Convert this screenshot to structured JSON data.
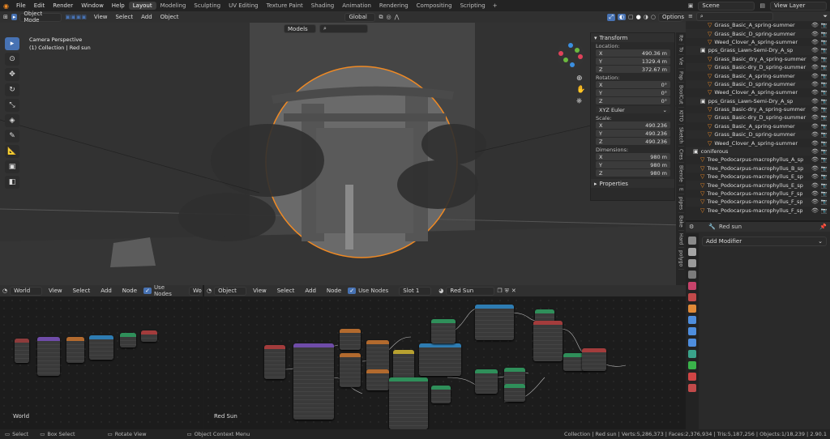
{
  "topbar": {
    "menus": [
      "File",
      "Edit",
      "Render",
      "Window",
      "Help"
    ],
    "workspaces": [
      "Layout",
      "Modeling",
      "Sculpting",
      "UV Editing",
      "Texture Paint",
      "Shading",
      "Animation",
      "Rendering",
      "Compositing",
      "Scripting"
    ],
    "active_workspace": "Layout",
    "scene": "Scene",
    "view_layer": "View Layer"
  },
  "viewport": {
    "mode": "Object Mode",
    "menus": [
      "View",
      "Select",
      "Add",
      "Object"
    ],
    "orientation": "Global",
    "options": "Options",
    "overlay_title": "Camera Perspective",
    "overlay_sub": "(1) Collection | Red sun",
    "models_label": "Models"
  },
  "npanel": {
    "transform": "Transform",
    "location_label": "Location:",
    "location": [
      {
        "axis": "X",
        "value": "490.36 m"
      },
      {
        "axis": "Y",
        "value": "1329.4 m"
      },
      {
        "axis": "Z",
        "value": "372.67 m"
      }
    ],
    "rotation_label": "Rotation:",
    "rotation": [
      {
        "axis": "X",
        "value": "0°"
      },
      {
        "axis": "Y",
        "value": "0°"
      },
      {
        "axis": "Z",
        "value": "0°"
      }
    ],
    "rotation_mode": "XYZ Euler",
    "scale_label": "Scale:",
    "scale": [
      {
        "axis": "X",
        "value": "490.236"
      },
      {
        "axis": "Y",
        "value": "490.236"
      },
      {
        "axis": "Z",
        "value": "490.236"
      }
    ],
    "dimensions_label": "Dimensions:",
    "dimensions": [
      {
        "axis": "X",
        "value": "980 m"
      },
      {
        "axis": "Y",
        "value": "980 m"
      },
      {
        "axis": "Z",
        "value": "980 m"
      }
    ],
    "properties": "Properties"
  },
  "vtabs": [
    "Ite",
    "To",
    "Vie",
    "Pap",
    "BoolCut",
    "KITO",
    "Sketch",
    "Cres",
    "Blende",
    "E",
    "pipes",
    "Bake",
    "Hard",
    "polygo"
  ],
  "outliner": {
    "search": "",
    "rows": [
      {
        "indent": 3,
        "label": "Grass_Basic_A_spring-summer"
      },
      {
        "indent": 3,
        "label": "Grass_Basic_D_spring-summer"
      },
      {
        "indent": 3,
        "label": "Weed_Clover_A_spring-summer"
      },
      {
        "indent": 2,
        "label": "pps_Grass_Lawn-Semi-Dry_A_sp"
      },
      {
        "indent": 3,
        "label": "Grass_Basic_dry_A_spring-summer"
      },
      {
        "indent": 3,
        "label": "Grass_Basic-dry_D_spring-summer"
      },
      {
        "indent": 3,
        "label": "Grass_Basic_A_spring-summer"
      },
      {
        "indent": 3,
        "label": "Grass_Basic_D_spring-summer"
      },
      {
        "indent": 3,
        "label": "Weed_Clover_A_spring-summer"
      },
      {
        "indent": 2,
        "label": "pps_Grass_Lawn-Semi-Dry_A_sp"
      },
      {
        "indent": 3,
        "label": "Grass_Basic-dry_A_spring-summer"
      },
      {
        "indent": 3,
        "label": "Grass_Basic-dry_D_spring-summer"
      },
      {
        "indent": 3,
        "label": "Grass_Basic_A_spring-summer"
      },
      {
        "indent": 3,
        "label": "Grass_Basic_D_spring-summer"
      },
      {
        "indent": 3,
        "label": "Weed_Clover_A_spring-summer"
      },
      {
        "indent": 1,
        "label": "coniferous"
      },
      {
        "indent": 2,
        "label": "Tree_Podocarpus-macrophyllus_A_sp"
      },
      {
        "indent": 2,
        "label": "Tree_Podocarpus-macrophyllus_B_sp"
      },
      {
        "indent": 2,
        "label": "Tree_Podocarpus-macrophyllus_E_sp"
      },
      {
        "indent": 2,
        "label": "Tree_Podocarpus-macrophyllus_E_sp"
      },
      {
        "indent": 2,
        "label": "Tree_Podocarpus-macrophyllus_F_sp"
      },
      {
        "indent": 2,
        "label": "Tree_Podocarpus-macrophyllus_F_sp"
      },
      {
        "indent": 2,
        "label": "Tree_Podocarpus-macrophyllus_F_sp"
      }
    ]
  },
  "properties": {
    "object_name": "Red sun",
    "add_modifier": "Add Modifier"
  },
  "node_left": {
    "type": "World",
    "menus": [
      "View",
      "Select",
      "Add",
      "Node"
    ],
    "use_nodes": "Use Nodes",
    "tab": "Wo",
    "label": "World"
  },
  "node_right": {
    "type": "Object",
    "menus": [
      "View",
      "Select",
      "Add",
      "Node"
    ],
    "use_nodes": "Use Nodes",
    "slot": "Slot 1",
    "material": "Red Sun",
    "label": "Red Sun"
  },
  "statusbar": {
    "select": "Select",
    "box_select": "Box Select",
    "rotate_view": "Rotate View",
    "context_menu": "Object Context Menu",
    "stats": "Collection | Red sun | Verts:5,286,373 | Faces:2,376,934 | Tris:5,187,256 | Objects:1/18,239 | 2.90.1"
  },
  "colors": {
    "accent": "#4772b3",
    "orange": "#f08a24",
    "viewport_bg": "#3d3d3d"
  }
}
